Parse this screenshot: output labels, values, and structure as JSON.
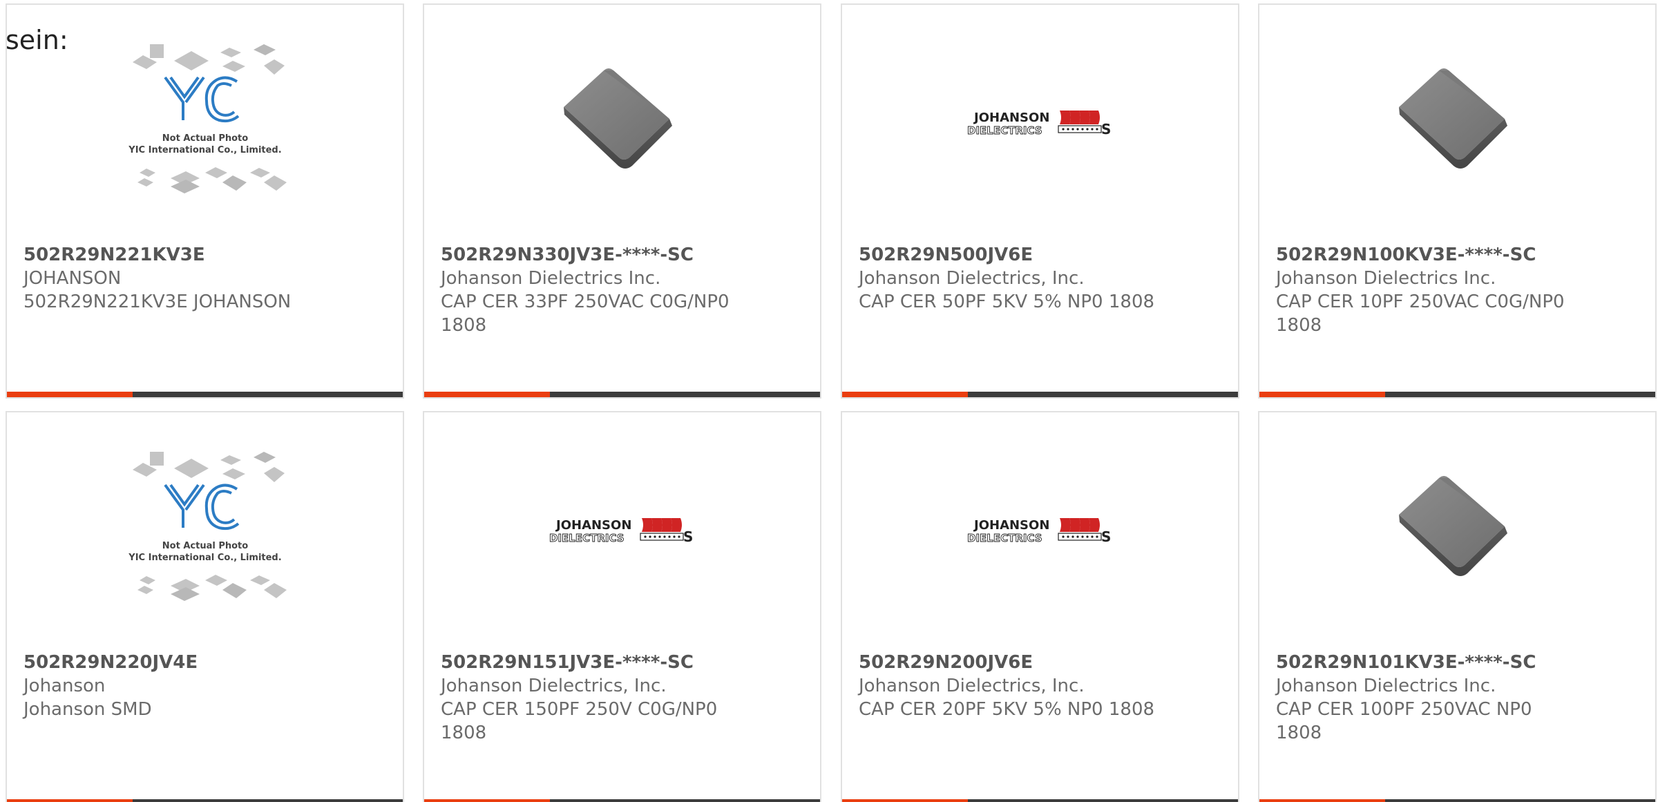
{
  "intro_text": "sein:",
  "colors": {
    "accent": "#ea3e10",
    "bar": "#3c3c3c",
    "border": "#e1e1e1",
    "title_text": "#555555",
    "body_text": "#6b6b6b",
    "yic_blue": "#2c7cc4"
  },
  "placeholder": {
    "line1": "Not Actual Photo",
    "line2": "YIC International Co., Limited."
  },
  "brand_logo": {
    "line1": "JOHANSON",
    "line2": "DIELECTRICS"
  },
  "products": [
    {
      "image": "yic-placeholder",
      "part_number": "502R29N221KV3E",
      "manufacturer": "JOHANSON",
      "description": "502R29N221KV3E JOHANSON"
    },
    {
      "image": "ceramic-chip-photo",
      "part_number": "502R29N330JV3E-****-SC",
      "manufacturer": "Johanson Dielectrics Inc.",
      "description": "CAP CER 33PF 250VAC C0G/NP0 1808"
    },
    {
      "image": "johanson-logo",
      "part_number": "502R29N500JV6E",
      "manufacturer": "Johanson Dielectrics, Inc.",
      "description": "CAP CER 50PF 5KV 5% NP0 1808"
    },
    {
      "image": "ceramic-chip-photo",
      "part_number": "502R29N100KV3E-****-SC",
      "manufacturer": "Johanson Dielectrics Inc.",
      "description": "CAP CER 10PF 250VAC C0G/NP0 1808"
    },
    {
      "image": "yic-placeholder",
      "part_number": "502R29N220JV4E",
      "manufacturer": "Johanson",
      "description": "Johanson SMD"
    },
    {
      "image": "johanson-logo",
      "part_number": "502R29N151JV3E-****-SC",
      "manufacturer": "Johanson Dielectrics, Inc.",
      "description": "CAP CER 150PF 250V C0G/NP0 1808"
    },
    {
      "image": "johanson-logo",
      "part_number": "502R29N200JV6E",
      "manufacturer": "Johanson Dielectrics, Inc.",
      "description": "CAP CER 20PF 5KV 5% NP0 1808"
    },
    {
      "image": "ceramic-chip-photo",
      "part_number": "502R29N101KV3E-****-SC",
      "manufacturer": "Johanson Dielectrics Inc.",
      "description": "CAP CER 100PF 250VAC NP0 1808"
    }
  ]
}
